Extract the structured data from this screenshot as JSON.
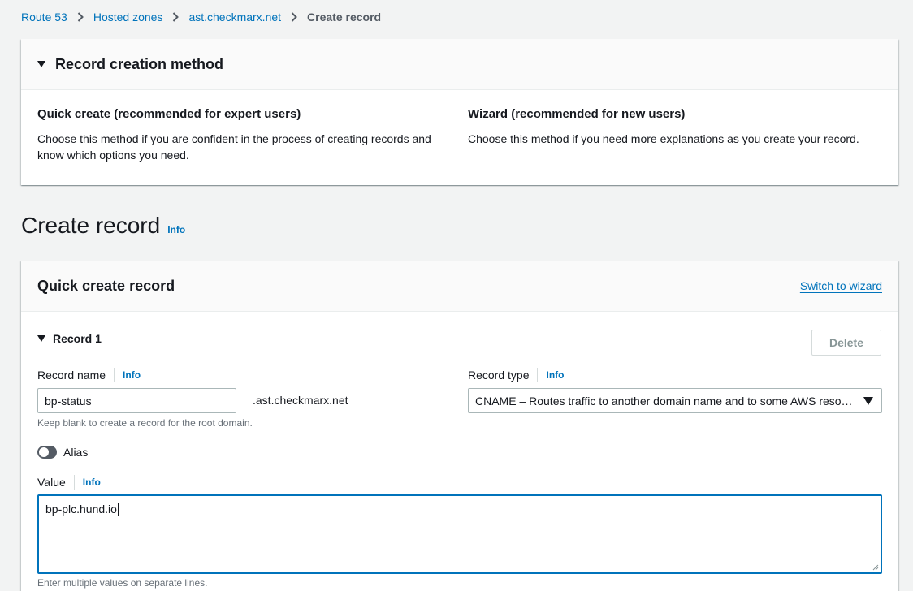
{
  "breadcrumb": {
    "items": [
      "Route 53",
      "Hosted zones",
      "ast.checkmarx.net"
    ],
    "current": "Create record"
  },
  "method_panel": {
    "title": "Record creation method",
    "quick": {
      "title": "Quick create (recommended for expert users)",
      "desc": "Choose this method if you are confident in the process of creating records and know which options you need."
    },
    "wizard": {
      "title": "Wizard (recommended for new users)",
      "desc": "Choose this method if you need more explanations as you create your record."
    }
  },
  "page": {
    "title": "Create record",
    "info": "Info"
  },
  "record_panel": {
    "title": "Quick create record",
    "switch_link": "Switch to wizard",
    "record_label": "Record 1",
    "delete_label": "Delete",
    "record_name": {
      "label": "Record name",
      "info": "Info",
      "value": "bp-status",
      "suffix": ".ast.checkmarx.net",
      "hint": "Keep blank to create a record for the root domain."
    },
    "record_type": {
      "label": "Record type",
      "info": "Info",
      "selected": "CNAME – Routes traffic to another domain name and to some AWS reso…"
    },
    "alias": {
      "label": "Alias",
      "enabled": false
    },
    "value": {
      "label": "Value",
      "info": "Info",
      "text": "bp-plc.hund.io",
      "hint": "Enter multiple values on separate lines."
    }
  },
  "colors": {
    "link": "#0073bb",
    "background": "#f2f3f3",
    "focus_border": "#0073bb"
  }
}
